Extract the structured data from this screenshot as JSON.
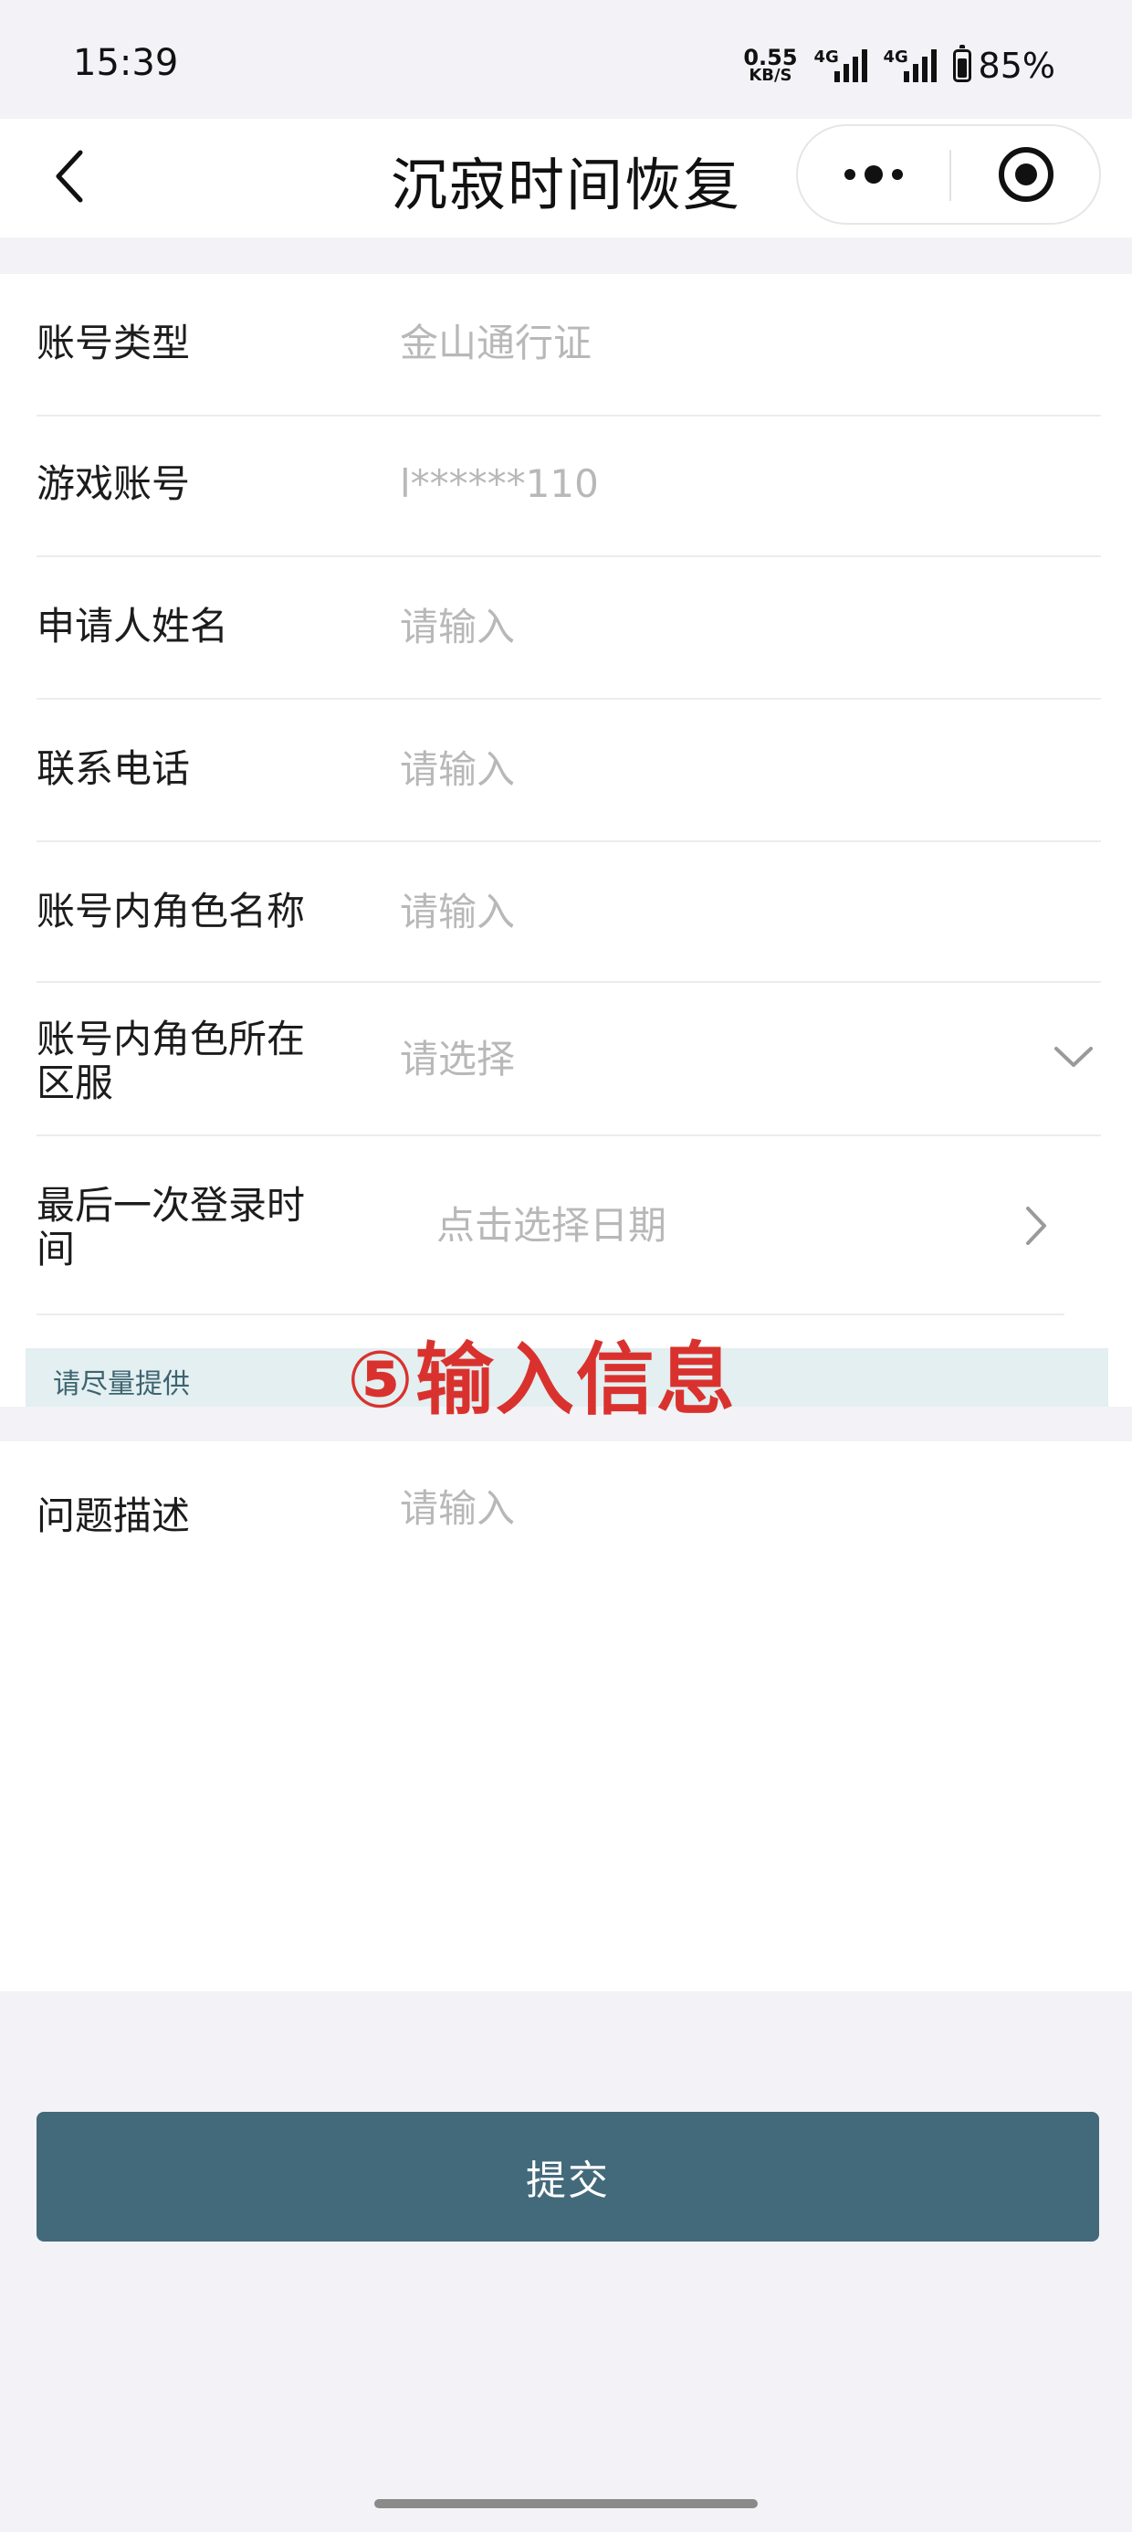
{
  "status_bar": {
    "time": "15:39",
    "net_speed": "0.55",
    "net_unit": "KB/S",
    "signal1": "4G",
    "signal2": "4G",
    "battery": "85%",
    "battery_level": 0.85
  },
  "nav": {
    "title": "沉寂时间恢复",
    "back_icon": "chevron-left-icon",
    "more_icon": "more-dots-icon",
    "close_icon": "target-close-icon"
  },
  "form": {
    "account_type": {
      "label": "账号类型",
      "value": "金山通行证"
    },
    "game_account": {
      "label": "游戏账号",
      "value": "l******110"
    },
    "applicant_name": {
      "label": "申请人姓名",
      "placeholder": "请输入"
    },
    "phone": {
      "label": "联系电话",
      "placeholder": "请输入"
    },
    "role_name": {
      "label": "账号内角色名称",
      "placeholder": "请输入"
    },
    "server": {
      "label_line1": "账号内角色所在",
      "label_line2": "区服",
      "placeholder": "请选择"
    },
    "last_login": {
      "label_line1": "最后一次登录时",
      "label_line2": "间",
      "placeholder": "点击选择日期"
    },
    "hint": "请尽量提供",
    "annotation": "⑤输入信息",
    "description": {
      "label": "问题描述",
      "placeholder": "请输入"
    }
  },
  "submit_label": "提交",
  "colors": {
    "primary": "#436a7a",
    "hint_bg": "#e3eff0",
    "annotation": "#d9322e",
    "placeholder": "#b8b8b8"
  }
}
